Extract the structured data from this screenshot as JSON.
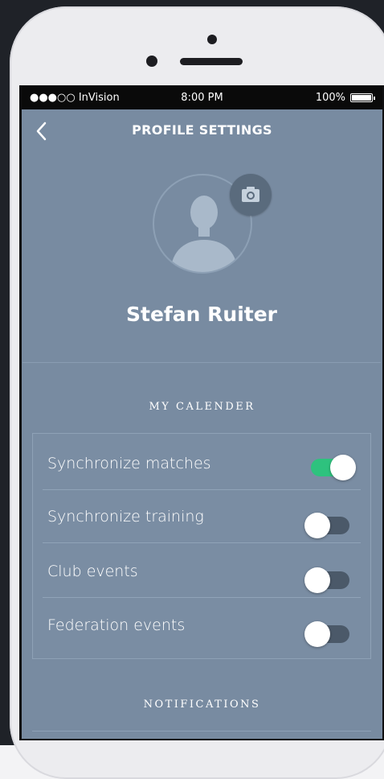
{
  "status_bar": {
    "carrier": "●●●○○ InVision",
    "time": "8:00 PM",
    "battery": "100%"
  },
  "header": {
    "title": "PROFILE SETTINGS"
  },
  "profile": {
    "name": "Stefan Ruiter"
  },
  "calendar": {
    "section_title": "MY CALENDER",
    "items": [
      {
        "label": "Synchronize matches",
        "enabled": true
      },
      {
        "label": "Synchronize training",
        "enabled": false
      },
      {
        "label": "Club events",
        "enabled": false
      },
      {
        "label": "Federation events",
        "enabled": false
      }
    ]
  },
  "notifications": {
    "section_title": "NOTIFICATIONS"
  },
  "colors": {
    "screen_bg": "#788ba1",
    "toggle_on": "#2ec27e",
    "toggle_off": "#4b5969"
  }
}
